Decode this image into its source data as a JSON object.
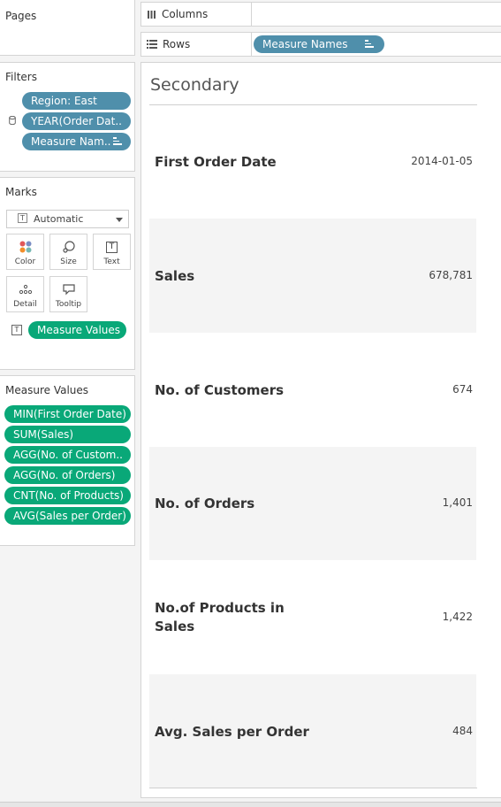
{
  "pages": {
    "title": "Pages"
  },
  "shelves": {
    "columns_label": "Columns",
    "rows_label": "Rows",
    "rows_pill": "Measure Names"
  },
  "filters": {
    "title": "Filters",
    "items": [
      "Region: East",
      "YEAR(Order Dat..",
      "Measure Nam.."
    ]
  },
  "marks": {
    "title": "Marks",
    "type": "Automatic",
    "buttons": [
      "Color",
      "Size",
      "Text",
      "Detail",
      "Tooltip"
    ],
    "text_pill": "Measure Values"
  },
  "measure_values": {
    "title": "Measure Values",
    "items": [
      "MIN(First Order Date)",
      "SUM(Sales)",
      "AGG(No. of Custom..",
      "AGG(No. of Orders)",
      "CNT(No. of Products)",
      "AVG(Sales per Order)"
    ]
  },
  "view": {
    "title": "Secondary",
    "rows": [
      {
        "label": "First Order Date",
        "value": "2014-01-05"
      },
      {
        "label": "Sales",
        "value": "678,781"
      },
      {
        "label": "No. of Customers",
        "value": "674"
      },
      {
        "label": "No. of Orders",
        "value": "1,401"
      },
      {
        "label": "No.of Products in Sales",
        "label_line1": "No.of Products in",
        "label_line2": "Sales",
        "value": "1,422"
      },
      {
        "label": "Avg. Sales per Order",
        "value": "484"
      }
    ]
  },
  "colors": {
    "pill_blue": "#4f8fab",
    "pill_green": "#09a878",
    "band": "#f4f4f4"
  }
}
